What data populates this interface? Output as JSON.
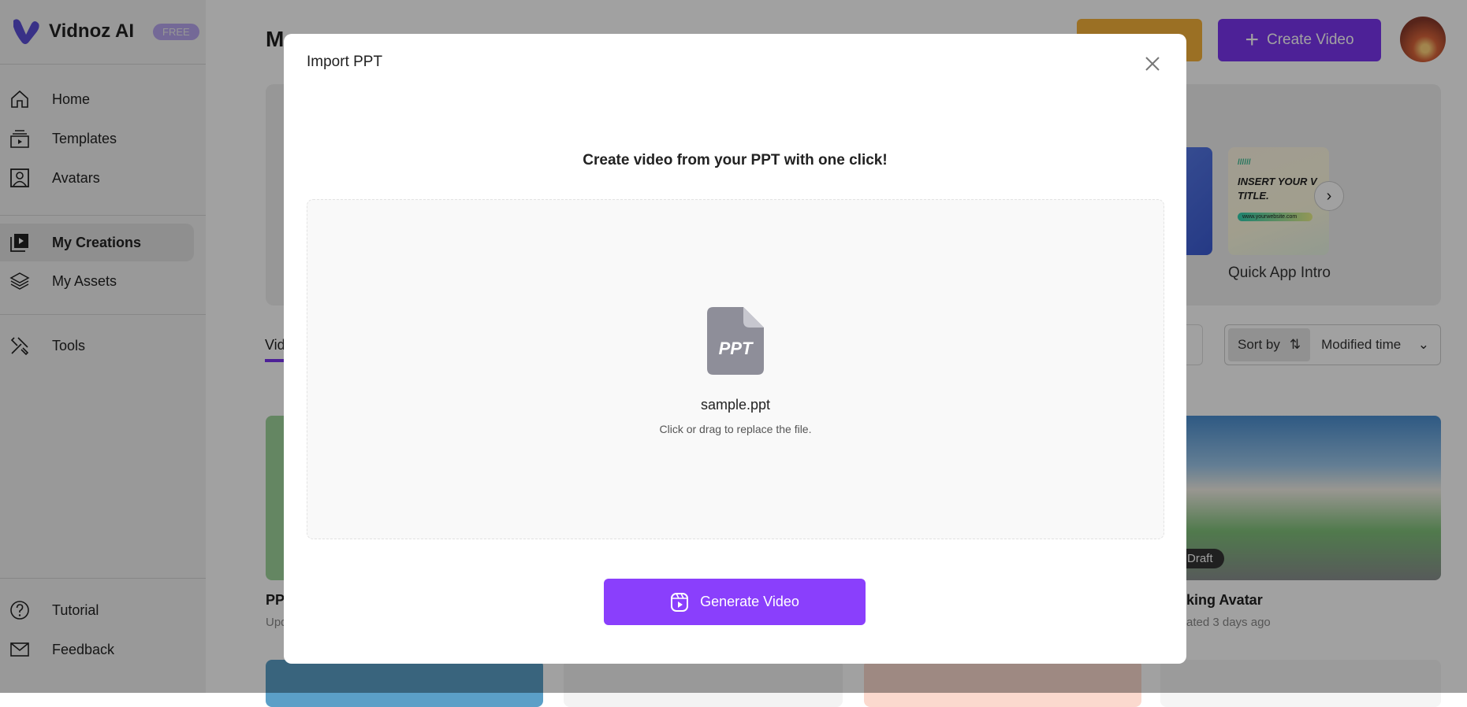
{
  "sidebar": {
    "brand": "Vidnoz AI",
    "badge": "FREE",
    "items": [
      {
        "label": "Home",
        "icon": "home-icon"
      },
      {
        "label": "Templates",
        "icon": "templates-icon"
      },
      {
        "label": "Avatars",
        "icon": "avatar-icon"
      },
      {
        "label": "My Creations",
        "icon": "creations-icon",
        "active": true
      },
      {
        "label": "My Assets",
        "icon": "layers-icon"
      },
      {
        "label": "Tools",
        "icon": "tools-icon"
      },
      {
        "label": "Tutorial",
        "icon": "question-icon"
      },
      {
        "label": "Feedback",
        "icon": "mail-icon"
      }
    ]
  },
  "header": {
    "title_visible": "M",
    "create_label": "Create Video"
  },
  "banner": {
    "template_title": "INSERT YOUR V TITLE.",
    "template_url": "www.yourwebsite.com",
    "template_name": "Quick App Intro"
  },
  "toolbar": {
    "tab_visible": "Vid",
    "sort_label": "Sort by",
    "sort_value": "Modified time"
  },
  "cards": [
    {
      "title_visible": "PP",
      "sub_visible": "Upd"
    },
    {
      "badge": "Draft",
      "title_visible": "king Avatar",
      "sub_visible": "ated 3 days ago"
    }
  ],
  "modal": {
    "title": "Import PPT",
    "heading": "Create video from your PPT with one click!",
    "file_icon_label": "PPT",
    "file_name": "sample.ppt",
    "hint": "Click or drag to replace the file.",
    "generate_label": "Generate Video"
  },
  "colors": {
    "accent": "#8a3ffc",
    "create_button": "#7a35f0",
    "orange_button": "#f6b23a",
    "overlay": "rgba(0,0,0,0.37)"
  }
}
